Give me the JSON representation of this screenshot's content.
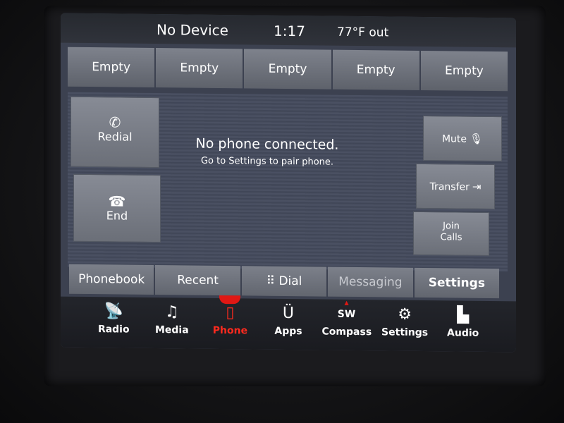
{
  "status": {
    "device": "No Device",
    "time": "1:17",
    "temperature": "77°F out"
  },
  "presets": [
    "Empty",
    "Empty",
    "Empty",
    "Empty",
    "Empty"
  ],
  "call_buttons": {
    "redial": {
      "label": "Redial",
      "icon": "phone-icon"
    },
    "end": {
      "label": "End",
      "icon": "hangup-icon"
    },
    "mute": {
      "label": "Mute",
      "icon": "mic-mute-icon"
    },
    "transfer": {
      "label": "Transfer",
      "icon": "transfer-icon"
    },
    "join_calls": {
      "label_line1": "Join",
      "label_line2": "Calls",
      "icon": "join-icon"
    }
  },
  "message": {
    "title": "No phone connected.",
    "subtitle": "Go to Settings to pair phone."
  },
  "tabs": {
    "phonebook": "Phonebook",
    "recent": "Recent",
    "dial": "Dial",
    "messaging": "Messaging",
    "settings": "Settings"
  },
  "nav": {
    "radio": "Radio",
    "media": "Media",
    "phone": "Phone",
    "apps": "Apps",
    "compass": "Compass",
    "compass_heading": "SW",
    "settings": "Settings",
    "audio": "Audio"
  },
  "colors": {
    "active_accent": "#ff2a1e",
    "screen_bg": "#3c4150"
  }
}
